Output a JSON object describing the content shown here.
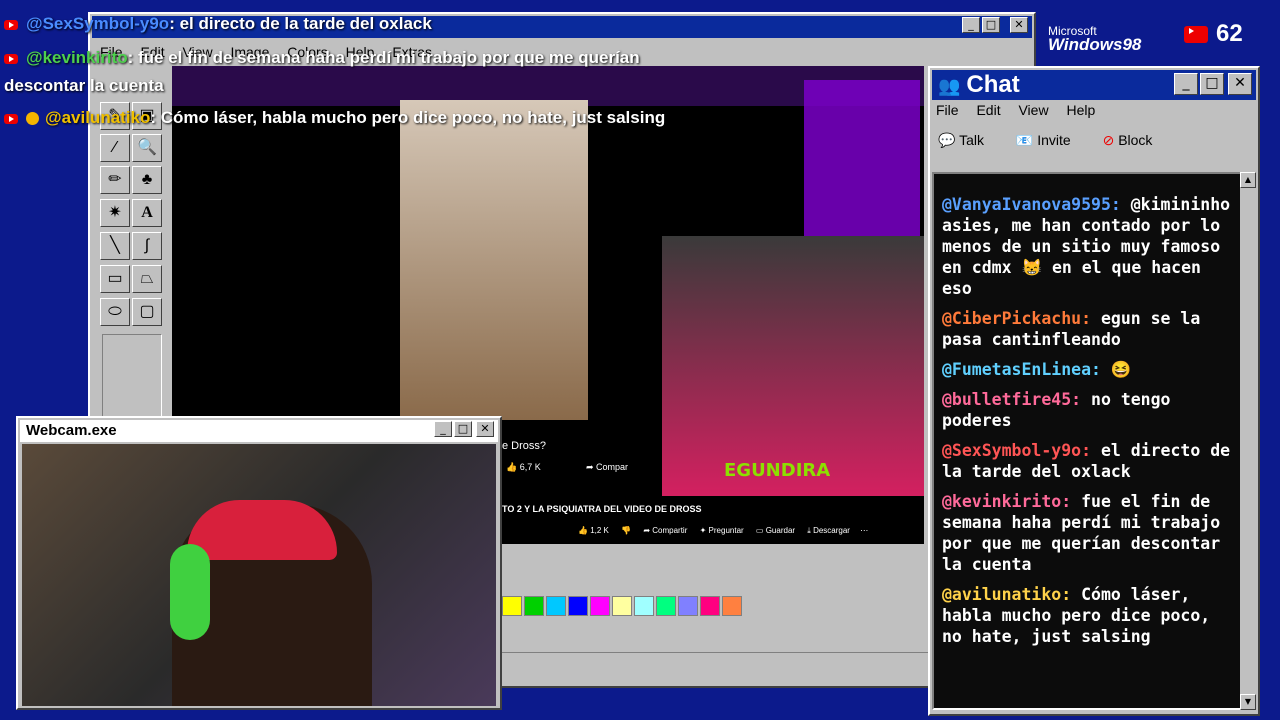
{
  "overlay": {
    "lines": [
      {
        "user": "@SexSymbol-y9o",
        "text": ": el directo de la tarde del oxlack"
      },
      {
        "user": "@kevinkirito",
        "text": ": fue el fin de semana haha perdí mi trabajo por que me querían"
      },
      {
        "cont": "descontar la cuenta"
      },
      {
        "user": "@avilunatiko",
        "text": ": Cómo láser, habla mucho pero dice poco, no hate, just salsing"
      }
    ]
  },
  "brand": {
    "ms": "Microsoft",
    "win": "Windows98"
  },
  "viewers": {
    "count": "62"
  },
  "paint": {
    "menu": [
      "File",
      "Edit",
      "View",
      "Image",
      "Colors",
      "Help",
      "Extras"
    ],
    "palette": [
      "#ffff00",
      "#00d000",
      "#00c8ff",
      "#0000ff",
      "#ff00ff",
      "#ffffa0",
      "#a0ffff",
      "#00ff80",
      "#8080ff",
      "#ff0080",
      "#ff8040"
    ]
  },
  "video": {
    "title_partial": "e Dross?",
    "likes_top": "6,7 K",
    "share_top": "Compar",
    "title2": "TO 2 Y LA PSIQUIATRA DEL VIDEO DE DROSS",
    "likes2": "1,2 K",
    "actions": [
      "Compartir",
      "Preguntar",
      "Guardar",
      "Descargar"
    ],
    "logo_text": "EGUNDIRA"
  },
  "webcam": {
    "title": "Webcam.exe"
  },
  "chat": {
    "title": "Chat",
    "menu": [
      "File",
      "Edit",
      "View",
      "Help"
    ],
    "toolbar": {
      "talk": "Talk",
      "invite": "Invite",
      "block": "Block"
    },
    "messages": [
      {
        "user": "@VanyaIvanova9595:",
        "text": "@kimininho asies, me han contado por lo menos de un sitio muy famoso en cdmx 😸 en el que hacen eso",
        "color": "#5aa0ff"
      },
      {
        "user": "@CiberPickachu:",
        "text": "egun se la pasa cantinfleando",
        "color": "#ff7a3a"
      },
      {
        "user": "@FumetasEnLinea:",
        "text": "😆",
        "color": "#60d0ff"
      },
      {
        "user": "@bulletfire45:",
        "text": "no tengo poderes",
        "color": "#ff6a9a"
      },
      {
        "user": "@SexSymbol-y9o:",
        "text": "el directo de la tarde del oxlack",
        "color": "#ff5555"
      },
      {
        "user": "@kevinkirito:",
        "text": "fue el fin de semana haha perdí mi trabajo por que me querían descontar la cuenta",
        "color": "#ff6a9a"
      },
      {
        "user": "@avilunatiko:",
        "text": "Cómo láser, habla mucho pero dice poco, no hate, just salsing",
        "color": "#ffd24a"
      }
    ]
  }
}
